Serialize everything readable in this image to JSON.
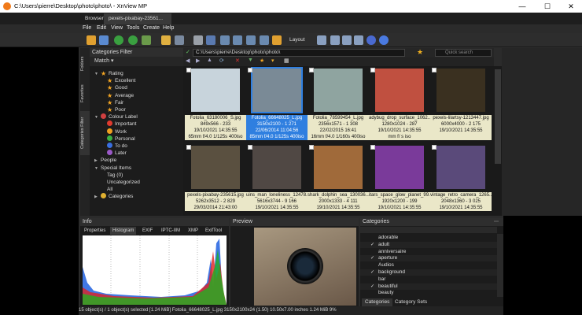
{
  "window": {
    "title": "C:\\Users\\pierre\\Desktop\\photo\\photo\\ - XnView MP",
    "min": "—",
    "max": "☐",
    "close": "✕"
  },
  "tabs": [
    {
      "label": "Browser"
    },
    {
      "label": "pexels-pixabay-23561..."
    }
  ],
  "menu": [
    "File",
    "Edit",
    "View",
    "Tools",
    "Create",
    "Help"
  ],
  "toolbar": {
    "layout_label": "Layout"
  },
  "left_tabs": [
    "Folders",
    "Favorites",
    "Categories Filter"
  ],
  "cat_filter": {
    "title": "Categories Filter",
    "match": "Match"
  },
  "tree": [
    {
      "label": "Rating",
      "level": 0,
      "icon": "star-icon",
      "color": "#f5a623"
    },
    {
      "label": "Excellent",
      "level": 1,
      "icon": "star-icon",
      "color": "#f5a623"
    },
    {
      "label": "Good",
      "level": 1,
      "icon": "star-icon",
      "color": "#f5a623"
    },
    {
      "label": "Average",
      "level": 1,
      "icon": "star-icon",
      "color": "#f5a623"
    },
    {
      "label": "Fair",
      "level": 1,
      "icon": "star-icon",
      "color": "#f5a623"
    },
    {
      "label": "Poor",
      "level": 1,
      "icon": "star-icon",
      "color": "#f5a623"
    },
    {
      "label": "Colour Label",
      "level": 0,
      "icon": "palette-icon",
      "color": "#d04040"
    },
    {
      "label": "Important",
      "level": 1,
      "icon": "dot-icon",
      "color": "#e03a2e"
    },
    {
      "label": "Work",
      "level": 1,
      "icon": "dot-icon",
      "color": "#f0a020"
    },
    {
      "label": "Personal",
      "level": 1,
      "icon": "dot-icon",
      "color": "#3cb043"
    },
    {
      "label": "To do",
      "level": 1,
      "icon": "dot-icon",
      "color": "#3a6fe0"
    },
    {
      "label": "Later",
      "level": 1,
      "icon": "dot-icon",
      "color": "#9b59c8"
    },
    {
      "label": "People",
      "level": 0,
      "icon": "",
      "color": ""
    },
    {
      "label": "Special Items",
      "level": 0,
      "icon": "",
      "color": ""
    },
    {
      "label": "Tag (0)",
      "level": 1,
      "icon": "",
      "color": ""
    },
    {
      "label": "Uncategorized",
      "level": 1,
      "icon": "",
      "color": ""
    },
    {
      "label": "All",
      "level": 1,
      "icon": "",
      "color": ""
    },
    {
      "label": "Categories",
      "level": 0,
      "icon": "folder-icon",
      "color": "#e0b030"
    }
  ],
  "address": {
    "path": "C:\\Users\\pierre\\Desktop\\photo\\photo\\",
    "search_placeholder": "Quick search"
  },
  "thumbs": [
    {
      "name": "Fotolia_63180006_S.jpg",
      "l2": "849x566 - 233",
      "l3": "19/10/2021 14:35:55",
      "l4": "65mm f/4.0 1/125s 400iso",
      "color": "#c8d4dc",
      "selected": false
    },
    {
      "name": "Fotolia_66648025_L.jpg",
      "l2": "3150x2100 - 1 271",
      "l3": "22/06/2014 11:04:56",
      "l4": "85mm f/4.0 1/125s 400iso",
      "color": "#7a8a96",
      "selected": true
    },
    {
      "name": "Fotolia_78599454_L.jpg",
      "l2": "2356x1571 - 1 308",
      "l3": "22/02/2015 16:41",
      "l4": "16mm f/4.0 1/160s 400iso",
      "color": "#8fa4a0",
      "selected": false
    },
    {
      "name": "adybug_drop_surface_1062...",
      "l2": "1280x1024 - 287",
      "l3": "19/10/2021 14:35:55",
      "l4": "mm f/ s iso",
      "color": "#c05040",
      "selected": false
    },
    {
      "name": "pexels-lilartsy-1213447.jpg",
      "l2": "6000x4000 - 2 175",
      "l3": "19/10/2021 14:35:55",
      "l4": "",
      "color": "#3a3020",
      "selected": false
    },
    {
      "name": "pexels-pixabay-235615.jpg",
      "l2": "5262x3512 - 2 829",
      "l3": "29/03/2014 21:43:00",
      "l4": "",
      "color": "#5a5040",
      "selected": false
    },
    {
      "name": "uins_man_loneliness_12478...",
      "l2": "5616x3744 - 9 166",
      "l3": "19/10/2021 14:35:55",
      "l4": "",
      "color": "#504844",
      "selected": false
    },
    {
      "name": "shark_dolphin_sea_130036...",
      "l2": "2000x1333 - 4 111",
      "l3": "19/10/2021 14:35:55",
      "l4": "",
      "color": "#a06a3a",
      "selected": false
    },
    {
      "name": "itars_space_glow_planet_99...",
      "l2": "1920x1200 - 199",
      "l3": "19/10/2021 14:35:55",
      "l4": "",
      "color": "#7a3a9a",
      "selected": false
    },
    {
      "name": "vintage_retro_camera_1265...",
      "l2": "2048x1360 - 3 025",
      "l3": "19/10/2021 14:35:55",
      "l4": "",
      "color": "#5a4a7a",
      "selected": false
    }
  ],
  "info": {
    "title": "Info",
    "tabs": [
      "Properties",
      "Histogram",
      "EXIF",
      "IPTC-IIM",
      "XMP",
      "ExifTool"
    ],
    "active_tab": 1
  },
  "preview": {
    "title": "Preview"
  },
  "categories": {
    "title": "Categories",
    "items": [
      {
        "label": "adorable",
        "checked": false
      },
      {
        "label": "adult",
        "checked": true
      },
      {
        "label": "anniversaire",
        "checked": false
      },
      {
        "label": "aperture",
        "checked": true
      },
      {
        "label": "Audios",
        "checked": false
      },
      {
        "label": "background",
        "checked": true
      },
      {
        "label": "bar",
        "checked": false
      },
      {
        "label": "beautiful",
        "checked": true
      },
      {
        "label": "beauty",
        "checked": false
      }
    ],
    "tabs": [
      "Categories",
      "Category Sets"
    ]
  },
  "status": "15 object(s) / 1 object(s) selected [1.24 MiB]   Fotolia_66648025_L.jpg   3150x2100x24 (1.50)   10.50x7.00 inches   1.24 MiB   9%"
}
